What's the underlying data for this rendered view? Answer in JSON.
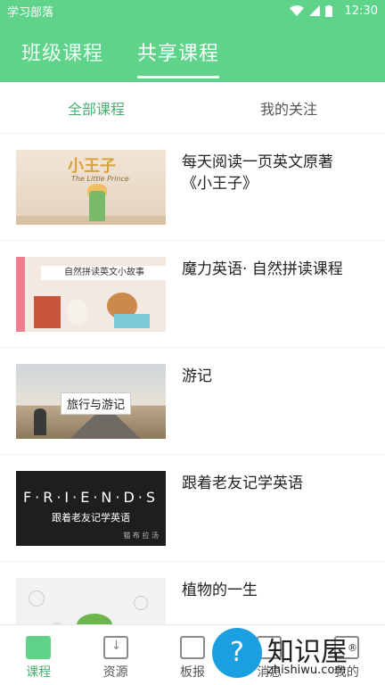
{
  "status_bar": {
    "app_name": "学习部落",
    "time": "12:30"
  },
  "header": {
    "tabs": [
      {
        "label": "班级课程"
      },
      {
        "label": "共享课程"
      }
    ]
  },
  "subtabs": [
    {
      "label": "全部课程"
    },
    {
      "label": "我的关注"
    }
  ],
  "courses": [
    {
      "title": "每天阅读一页英文原著《小王子》",
      "thumb_text": "小王子",
      "thumb_sub": "The Little Prince"
    },
    {
      "title": "魔力英语· 自然拼读课程",
      "thumb_text": "自然拼读英文小故事"
    },
    {
      "title": "游记",
      "thumb_text": "旅行与游记"
    },
    {
      "title": "跟着老友记学英语",
      "thumb_text": "F·R·I·E·N·D·S",
      "thumb_sub": "跟着老友记学英语",
      "thumb_mark": "猫 布 拉 汤"
    },
    {
      "title": "植物的一生"
    }
  ],
  "bottom_nav": [
    {
      "label": "课程",
      "icon": "book-icon"
    },
    {
      "label": "资源",
      "icon": "download-icon"
    },
    {
      "label": "板报",
      "icon": "board-icon"
    },
    {
      "label": "消息",
      "icon": "message-icon"
    },
    {
      "label": "我的",
      "icon": "profile-icon"
    }
  ],
  "watermark": {
    "brand": "知识屋",
    "url": "zhishiwu.com",
    "mark": "®"
  },
  "colors": {
    "primary_green": "#5fd38a",
    "active_text": "#4caf73"
  }
}
